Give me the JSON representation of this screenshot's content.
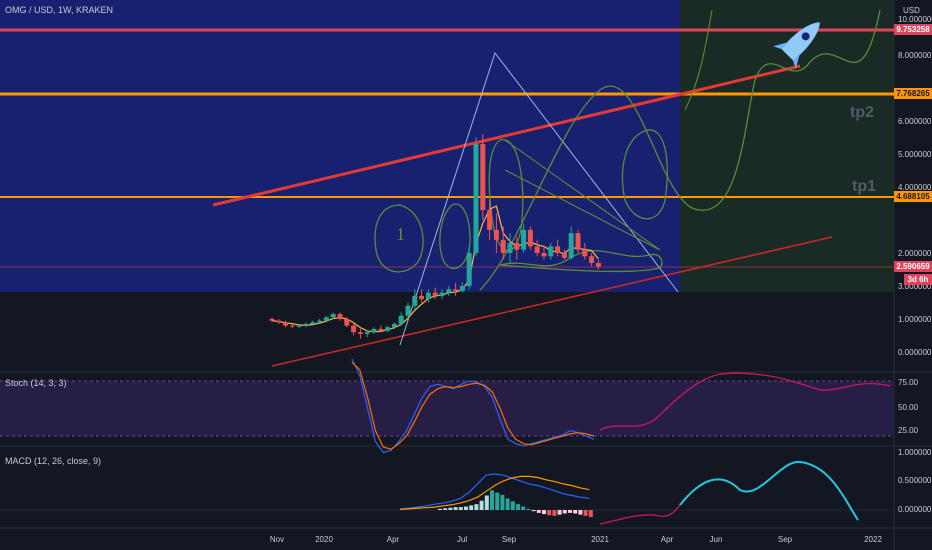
{
  "header": {
    "title": "OMG / USD, 1W, KRAKEN",
    "currency": "USD"
  },
  "colors": {
    "bg": "#131722",
    "zone_blue": "#1a237e",
    "zone_green": "#1b2e25",
    "up": "#26a69a",
    "down": "#ef5350",
    "level_red": "#e0445a",
    "level_orange": "#ff9800",
    "trend_red": "#e53935",
    "drawing_green": "#5b8c3a",
    "stoch_k": "#2962ff",
    "stoch_d": "#ff6d00",
    "macd_line": "#2962ff",
    "signal_line": "#ff9800",
    "projection": "#c2185b",
    "projection_macd": "#26c6da",
    "stoch_band": "#2a1f4a"
  },
  "chart_data": [
    {
      "type": "candlestick",
      "title": "OMG / USD, 1W, KRAKEN",
      "x_ticks": [
        "Nov",
        "2020",
        "Apr",
        "Jul",
        "Sep",
        "2021",
        "Apr",
        "Jun",
        "Sep",
        "2022"
      ],
      "y_ticks": [
        "1.000000",
        "0.000000",
        "2.000000",
        "3.000000",
        "4.000000",
        "5.000000",
        "6.000000",
        "7.000000",
        "8.000000",
        "9.000000",
        "10.000000"
      ],
      "price_levels": [
        {
          "value": 9.753258,
          "label": "9.753258",
          "color": "#e0445a"
        },
        {
          "value": 7.768265,
          "label": "7.768265",
          "color": "#ff9800"
        },
        {
          "value": 4.688105,
          "label": "4.688105",
          "color": "#ff9800"
        },
        {
          "value": 2.590659,
          "label": "2.590659",
          "color": "#e0445a"
        }
      ],
      "countdown": "3d 6h",
      "annotations": [
        "tp2",
        "tp1"
      ],
      "candles": [
        [
          1.0,
          1.05,
          0.9,
          0.95
        ],
        [
          0.95,
          1.0,
          0.85,
          0.9
        ],
        [
          0.9,
          0.95,
          0.75,
          0.8
        ],
        [
          0.8,
          0.85,
          0.72,
          0.78
        ],
        [
          0.78,
          0.85,
          0.72,
          0.8
        ],
        [
          0.8,
          0.9,
          0.75,
          0.85
        ],
        [
          0.85,
          0.95,
          0.8,
          0.9
        ],
        [
          0.9,
          1.0,
          0.85,
          0.95
        ],
        [
          0.95,
          1.1,
          0.9,
          1.05
        ],
        [
          1.05,
          1.2,
          1.0,
          1.15
        ],
        [
          1.15,
          1.2,
          0.95,
          1.0
        ],
        [
          1.0,
          1.05,
          0.75,
          0.8
        ],
        [
          0.8,
          0.85,
          0.5,
          0.6
        ],
        [
          0.6,
          0.7,
          0.4,
          0.55
        ],
        [
          0.55,
          0.65,
          0.45,
          0.6
        ],
        [
          0.6,
          0.75,
          0.55,
          0.7
        ],
        [
          0.7,
          0.8,
          0.6,
          0.65
        ],
        [
          0.65,
          0.8,
          0.6,
          0.75
        ],
        [
          0.75,
          0.9,
          0.7,
          0.85
        ],
        [
          0.85,
          1.2,
          0.8,
          1.1
        ],
        [
          1.1,
          1.5,
          1.0,
          1.4
        ],
        [
          1.4,
          1.9,
          1.3,
          1.7
        ],
        [
          1.7,
          1.9,
          1.5,
          1.6
        ],
        [
          1.6,
          1.9,
          1.5,
          1.8
        ],
        [
          1.8,
          1.95,
          1.6,
          1.7
        ],
        [
          1.7,
          1.9,
          1.6,
          1.8
        ],
        [
          1.8,
          2.0,
          1.7,
          1.9
        ],
        [
          1.9,
          2.1,
          1.7,
          1.85
        ],
        [
          1.85,
          2.1,
          1.8,
          2.0
        ],
        [
          2.0,
          3.2,
          1.9,
          3.0
        ],
        [
          3.0,
          6.5,
          2.9,
          6.3
        ],
        [
          6.3,
          6.6,
          4.0,
          4.3
        ],
        [
          4.3,
          4.6,
          3.4,
          3.7
        ],
        [
          3.7,
          4.2,
          3.0,
          3.4
        ],
        [
          3.4,
          3.8,
          2.8,
          3.0
        ],
        [
          3.0,
          3.6,
          2.7,
          3.3
        ],
        [
          3.3,
          3.5,
          2.8,
          3.1
        ],
        [
          3.1,
          3.9,
          3.0,
          3.7
        ],
        [
          3.7,
          3.8,
          3.1,
          3.2
        ],
        [
          3.2,
          3.4,
          2.9,
          3.0
        ],
        [
          3.0,
          3.2,
          2.8,
          2.9
        ],
        [
          2.9,
          3.3,
          2.8,
          3.2
        ],
        [
          3.2,
          3.4,
          2.9,
          3.0
        ],
        [
          3.0,
          3.1,
          2.8,
          2.85
        ],
        [
          2.85,
          3.8,
          2.8,
          3.6
        ],
        [
          3.6,
          3.7,
          3.0,
          3.1
        ],
        [
          3.1,
          3.3,
          2.8,
          2.9
        ],
        [
          2.9,
          3.0,
          2.6,
          2.7
        ],
        [
          2.7,
          2.8,
          2.5,
          2.59
        ]
      ]
    },
    {
      "type": "line",
      "title": "Stoch (14, 3, 3)",
      "y_ticks": [
        "75.00",
        "50.00",
        "25.00"
      ],
      "ylim": [
        0,
        100
      ],
      "series": [
        {
          "values": [
            95,
            80,
            50,
            20,
            10,
            12,
            20,
            30,
            45,
            60,
            70,
            72,
            70,
            68,
            72,
            75,
            74,
            70,
            60,
            40,
            22,
            18,
            16,
            18,
            20,
            22,
            24,
            26,
            30,
            28,
            25,
            22
          ]
        },
        {
          "values": [
            92,
            85,
            60,
            30,
            15,
            13,
            18,
            25,
            38,
            52,
            63,
            68,
            70,
            69,
            70,
            72,
            73,
            71,
            65,
            50,
            32,
            22,
            18,
            17,
            19,
            21,
            23,
            25,
            27,
            28,
            27,
            25
          ]
        }
      ]
    },
    {
      "type": "bar",
      "title": "MACD (12, 26, close, 9)",
      "y_ticks": [
        "1.000000",
        "0.500000",
        "0.000000"
      ],
      "ylim": [
        -0.15,
        1.0
      ],
      "histogram": [
        0.02,
        0.03,
        0.04,
        0.05,
        0.05,
        0.06,
        0.08,
        0.1,
        0.16,
        0.25,
        0.34,
        0.3,
        0.26,
        0.2,
        0.15,
        0.1,
        0.06,
        0.02,
        -0.02,
        -0.05,
        -0.07,
        -0.09,
        -0.1,
        -0.08,
        -0.06,
        -0.05,
        -0.06,
        -0.08,
        -0.1,
        -0.12
      ],
      "series": [
        {
          "values": [
            0.02,
            0.03,
            0.05,
            0.07,
            0.1,
            0.12,
            0.15,
            0.2,
            0.3,
            0.45,
            0.6,
            0.62,
            0.6,
            0.55,
            0.5,
            0.45,
            0.42,
            0.38,
            0.33,
            0.28,
            0.25,
            0.22,
            0.2
          ]
        },
        {
          "values": [
            0.01,
            0.02,
            0.03,
            0.04,
            0.05,
            0.07,
            0.09,
            0.12,
            0.16,
            0.22,
            0.32,
            0.42,
            0.5,
            0.55,
            0.58,
            0.58,
            0.56,
            0.52,
            0.49,
            0.45,
            0.42,
            0.38,
            0.35
          ]
        }
      ]
    }
  ]
}
